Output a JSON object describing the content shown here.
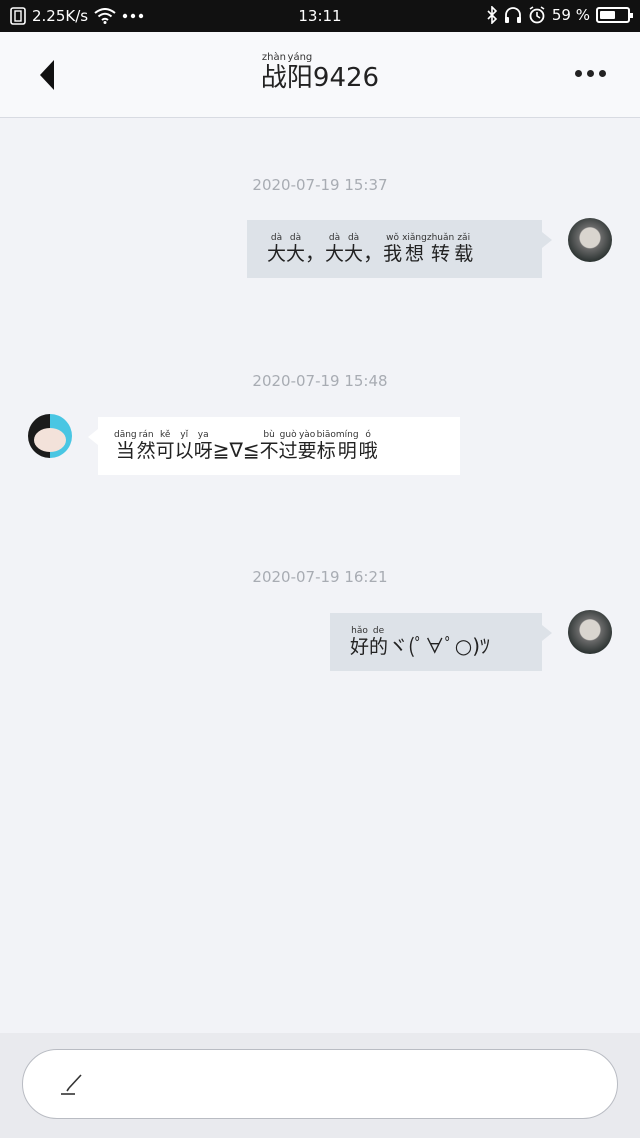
{
  "status_bar": {
    "speed": "2.25K/s",
    "time": "13:11",
    "battery": "59 %",
    "battery_level": 0.59,
    "icons": [
      "notification-icon",
      "wifi-icon",
      "more-dots-icon",
      "bluetooth-icon",
      "headphone-icon",
      "alarm-icon",
      "battery-icon"
    ]
  },
  "header": {
    "title_chars": [
      {
        "char": "战",
        "pinyin": "zhàn"
      },
      {
        "char": "阳",
        "pinyin": "yáng"
      }
    ],
    "title_suffix": "9426"
  },
  "messages": [
    {
      "timestamp": "2020-07-19 15:37",
      "direction": "out",
      "tokens": [
        {
          "char": "大",
          "pinyin": "dà"
        },
        {
          "char": "大",
          "pinyin": "dà"
        },
        {
          "char": "，"
        },
        {
          "char": "大",
          "pinyin": "dà"
        },
        {
          "char": "大",
          "pinyin": "dà"
        },
        {
          "char": "，"
        },
        {
          "char": "我",
          "pinyin": "wǒ"
        },
        {
          "char": "想",
          "pinyin": "xiǎng"
        },
        {
          "char": "转",
          "pinyin": "zhuǎn"
        },
        {
          "char": "载",
          "pinyin": "zǎi"
        }
      ]
    },
    {
      "timestamp": "2020-07-19 15:48",
      "direction": "in",
      "tokens": [
        {
          "char": "当",
          "pinyin": "dāng"
        },
        {
          "char": "然",
          "pinyin": "rán"
        },
        {
          "char": "可",
          "pinyin": "kě"
        },
        {
          "char": "以",
          "pinyin": "yǐ"
        },
        {
          "char": "呀",
          "pinyin": "ya"
        },
        {
          "char": "≧∇≦"
        },
        {
          "char": "不",
          "pinyin": "bù"
        },
        {
          "char": "过",
          "pinyin": "guò"
        },
        {
          "char": "要",
          "pinyin": "yào"
        },
        {
          "char": "标",
          "pinyin": "biāo"
        },
        {
          "char": "明",
          "pinyin": "míng"
        },
        {
          "char": "哦",
          "pinyin": "ó"
        }
      ]
    },
    {
      "timestamp": "2020-07-19 16:21",
      "direction": "out",
      "tokens": [
        {
          "char": "好",
          "pinyin": "hǎo"
        },
        {
          "char": "的",
          "pinyin": "de"
        },
        {
          "char": "ヾ(ﾟ∀ﾟ○)ﾂ"
        }
      ]
    }
  ],
  "input": {
    "placeholder": ""
  },
  "colors": {
    "background": "#f2f3f7",
    "bubble_out": "#dde2e8",
    "bubble_in": "#ffffff",
    "timestamp": "#a8acb3"
  }
}
